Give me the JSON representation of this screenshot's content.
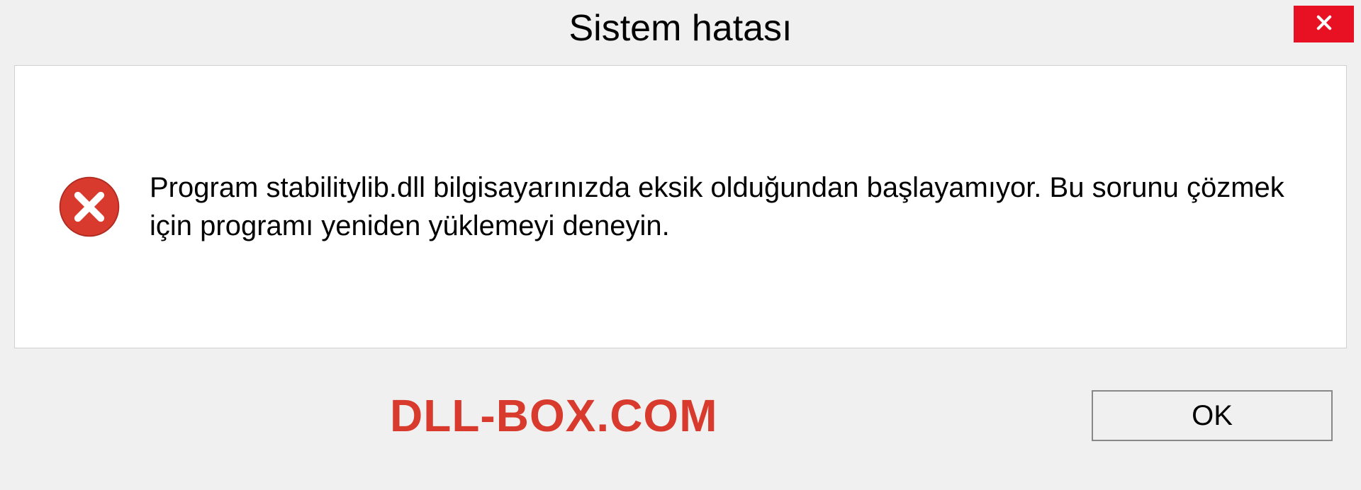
{
  "dialog": {
    "title": "Sistem hatası",
    "message": "Program stabilitylib.dll bilgisayarınızda eksik olduğundan başlayamıyor. Bu sorunu çözmek için programı yeniden yüklemeyi deneyin.",
    "ok_label": "OK",
    "watermark": "DLL-BOX.COM"
  },
  "colors": {
    "close_button": "#e81123",
    "error_icon": "#d83b2e",
    "watermark": "#d83b2e"
  }
}
